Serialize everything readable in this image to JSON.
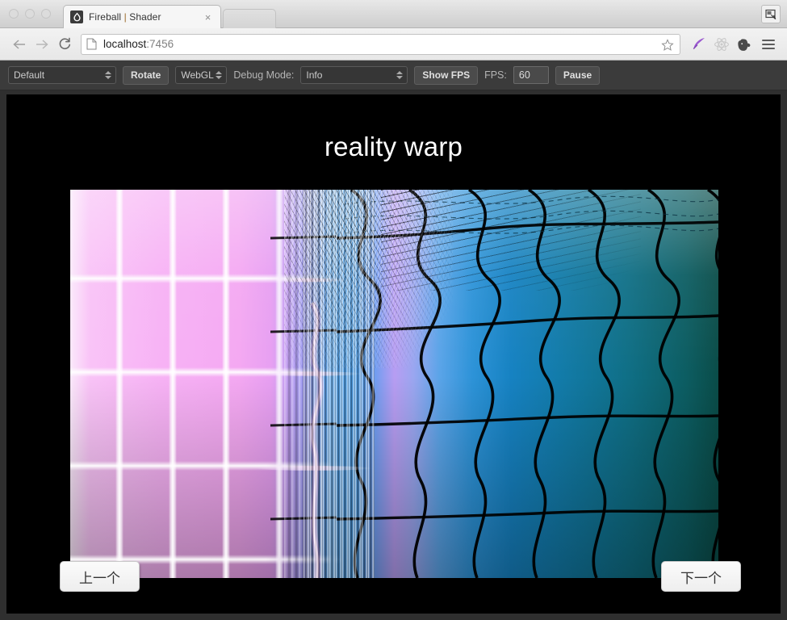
{
  "browser": {
    "tab": {
      "title_main": "Fireball",
      "separator": "|",
      "title_sub": "Shader",
      "close_label": "×",
      "favicon_name": "fireball-droplet-icon"
    },
    "address": {
      "host": "localhost",
      "port": ":7456",
      "page_icon": "document-icon",
      "star_icon": "bookmark-star-icon"
    },
    "nav": {
      "back": "←",
      "forward": "→",
      "reload": "↻"
    },
    "extensions": [
      {
        "name": "feather-icon",
        "label": ""
      },
      {
        "name": "react-icon",
        "label": ""
      },
      {
        "name": "evernote-icon",
        "label": ""
      }
    ],
    "menu_icon": "hamburger-menu-icon",
    "window_action_icon": "screenshot-icon"
  },
  "toolbar": {
    "profile_select": "Default",
    "rotate_button": "Rotate",
    "renderer_select": "WebGL",
    "debug_mode_label": "Debug Mode:",
    "debug_mode_select": "Info",
    "show_fps_button": "Show FPS",
    "fps_label": "FPS:",
    "fps_value": "60",
    "pause_button": "Pause"
  },
  "stage": {
    "title": "reality warp",
    "prev_button": "上一个",
    "next_button": "下一个",
    "background": "#000000",
    "title_color": "#ffffff"
  }
}
